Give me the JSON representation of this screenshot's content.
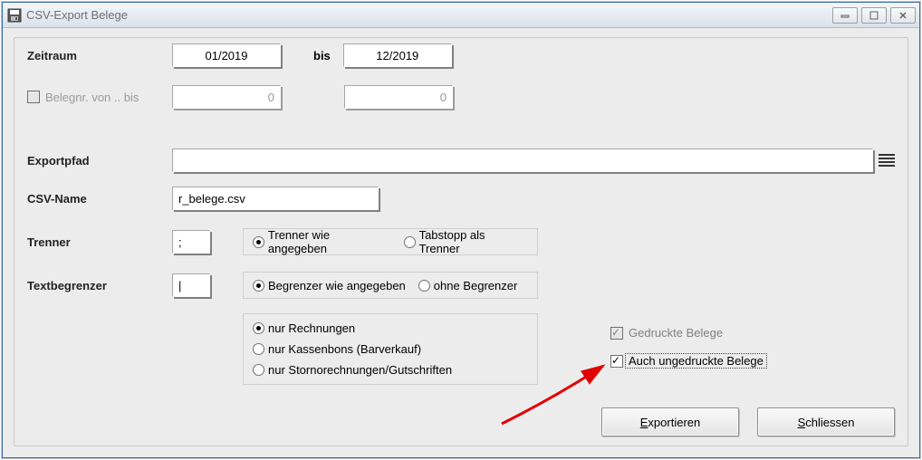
{
  "window": {
    "title": "CSV-Export Belege"
  },
  "labels": {
    "zeitraum": "Zeitraum",
    "belegnr": "Belegnr. von .. bis",
    "exportpfad": "Exportpfad",
    "csvname": "CSV-Name",
    "trenner": "Trenner",
    "textbegrenzer": "Textbegrenzer",
    "bis": "bis"
  },
  "values": {
    "zeitraum_from": "01/2019",
    "zeitraum_to": "12/2019",
    "belegnr_from": "0",
    "belegnr_to": "0",
    "exportpfad": "",
    "csvname": "r_belege.csv",
    "trenner": ";",
    "textbegrenzer": "|"
  },
  "trenner_options": {
    "opt1": "Trenner wie angegeben",
    "opt2": "Tabstopp als Trenner",
    "selected": "opt1"
  },
  "begrenzer_options": {
    "opt1": "Begrenzer wie angegeben",
    "opt2": "ohne Begrenzer",
    "selected": "opt1"
  },
  "doctype_options": {
    "opt1": "nur Rechnungen",
    "opt2": "nur Kassenbons (Barverkauf)",
    "opt3": "nur Stornorechnungen/Gutschriften",
    "selected": "opt1"
  },
  "checkboxes": {
    "gedruckte": "Gedruckte Belege",
    "auch_ungedruckte": "Auch ungedruckte Belege"
  },
  "buttons": {
    "export_pre": "E",
    "export_rest": "xportieren",
    "close_pre": "S",
    "close_rest": "chliessen"
  }
}
